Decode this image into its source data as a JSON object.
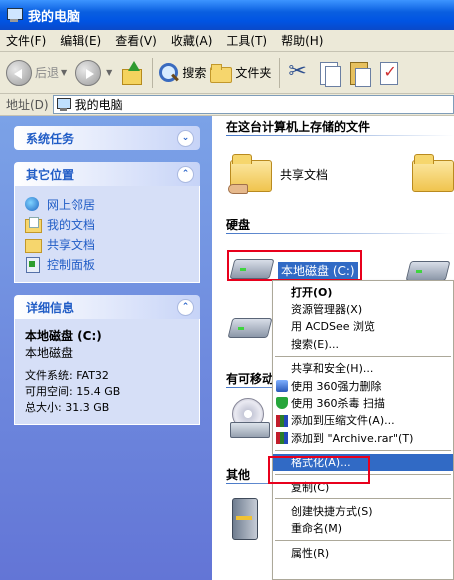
{
  "window": {
    "title": "我的电脑"
  },
  "menubar": [
    {
      "label": "文件(F)"
    },
    {
      "label": "编辑(E)"
    },
    {
      "label": "查看(V)"
    },
    {
      "label": "收藏(A)"
    },
    {
      "label": "工具(T)"
    },
    {
      "label": "帮助(H)"
    }
  ],
  "toolbar": {
    "back_label": "后退",
    "search_label": "搜索",
    "folders_label": "文件夹"
  },
  "address": {
    "label": "地址(D)",
    "value": "我的电脑"
  },
  "left_panel": {
    "system_tasks": {
      "title": "系统任务"
    },
    "other_places": {
      "title": "其它位置",
      "items": [
        {
          "label": "网上邻居",
          "icon": "network-icon"
        },
        {
          "label": "我的文档",
          "icon": "my-documents-icon"
        },
        {
          "label": "共享文档",
          "icon": "shared-folder-icon"
        },
        {
          "label": "控制面板",
          "icon": "control-panel-icon"
        }
      ]
    },
    "details": {
      "title": "详细信息",
      "name": "本地磁盘 (C:)",
      "type": "本地磁盘",
      "filesystem": "文件系统: FAT32",
      "free": "可用空间: 15.4 GB",
      "total": "总大小: 31.3 GB"
    }
  },
  "right_panel": {
    "groups": {
      "stored_files": "在这台计算机上存储的文件",
      "hard_disks": "硬盘",
      "removable": "有可移动",
      "other": "其他"
    },
    "items": {
      "shared_docs": "共享文档",
      "drive_c": "本地磁盘 (C:)"
    }
  },
  "context_menu": [
    {
      "label": "打开(O)",
      "bold": true
    },
    {
      "label": "资源管理器(X)"
    },
    {
      "label": "用 ACDSee 浏览"
    },
    {
      "label": "搜索(E)..."
    },
    {
      "sep": true
    },
    {
      "label": "共享和安全(H)..."
    },
    {
      "label": "使用 360强力删除",
      "icon": "360-delete-icon"
    },
    {
      "label": "使用 360杀毒 扫描",
      "icon": "360-antivirus-icon"
    },
    {
      "label": "添加到压缩文件(A)...",
      "icon": "winrar-icon"
    },
    {
      "label": "添加到 \"Archive.rar\"(T)",
      "icon": "winrar-icon"
    },
    {
      "sep": true
    },
    {
      "label": "格式化(A)...",
      "highlight": true
    },
    {
      "sep": true
    },
    {
      "label": "复制(C)"
    },
    {
      "sep": true
    },
    {
      "label": "创建快捷方式(S)"
    },
    {
      "label": "重命名(M)"
    },
    {
      "sep": true
    },
    {
      "label": "属性(R)"
    }
  ],
  "accent": {
    "selection": "#316ac5",
    "annotation": "#e8001c",
    "task_link": "#215dc6"
  }
}
